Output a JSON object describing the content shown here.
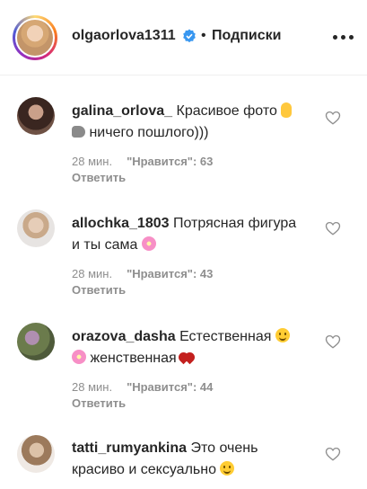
{
  "header": {
    "username": "olgaorlova1311",
    "separator": "•",
    "follow_label": "Подписки"
  },
  "comments": [
    {
      "username": "galina_orlova_",
      "text_part1": "Красивое фото",
      "text_part2": "ничего пошлого)))",
      "time": "28 мин.",
      "likes_label": "\"Нравится\"",
      "likes_count": ": 63",
      "reply": "Ответить"
    },
    {
      "username": "allochka_1803",
      "text_part1": "Потрясная фигура",
      "text_part2": "и ты сама",
      "time": "28 мин.",
      "likes_label": "\"Нравится\"",
      "likes_count": ": 43",
      "reply": "Ответить"
    },
    {
      "username": "orazova_dasha",
      "text_part1": "Естественная",
      "text_part2": "женственная",
      "time": "28 мин.",
      "likes_label": "\"Нравится\"",
      "likes_count": ": 44",
      "reply": "Ответить"
    },
    {
      "username": "tatti_rumyankina",
      "text_part1": "Это очень",
      "text_part2": "красиво и сексуально"
    }
  ],
  "colors": {
    "text_primary": "#262626",
    "text_secondary": "#8e8e8e",
    "verified_blue": "#3897f0"
  }
}
